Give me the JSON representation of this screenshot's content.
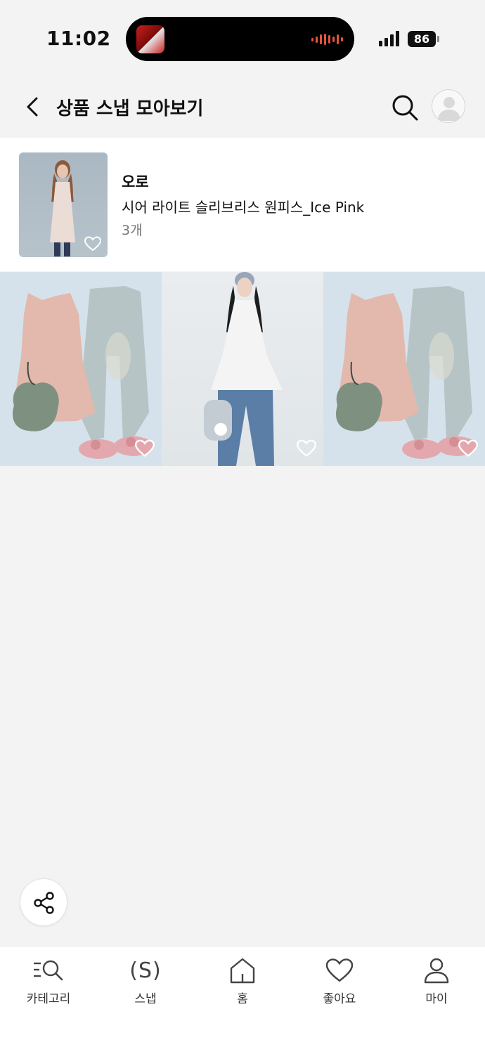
{
  "status_bar": {
    "time": "11:02",
    "battery": "86"
  },
  "header": {
    "title": "상품 스냅 모아보기",
    "back_icon": "chevron-left-icon",
    "search_icon": "search-icon",
    "avatar_icon": "user-avatar-icon"
  },
  "product": {
    "brand": "오로",
    "name": "시어 라이트 슬리브리스 원피스_Ice Pink",
    "count": "3개"
  },
  "snaps": [
    {
      "type": "flatlay",
      "liked": false
    },
    {
      "type": "model",
      "liked": false
    },
    {
      "type": "flatlay",
      "liked": false
    }
  ],
  "share_icon": "share-icon",
  "tabbar": {
    "items": [
      {
        "label": "카테고리",
        "icon": "category-search-icon"
      },
      {
        "label": "스냅",
        "icon": "snap-icon"
      },
      {
        "label": "홈",
        "icon": "home-icon"
      },
      {
        "label": "좋아요",
        "icon": "heart-icon"
      },
      {
        "label": "마이",
        "icon": "person-icon"
      }
    ]
  },
  "colors": {
    "background": "#f3f3f3",
    "card": "#ffffff",
    "text": "#111111",
    "muted": "#777777"
  }
}
